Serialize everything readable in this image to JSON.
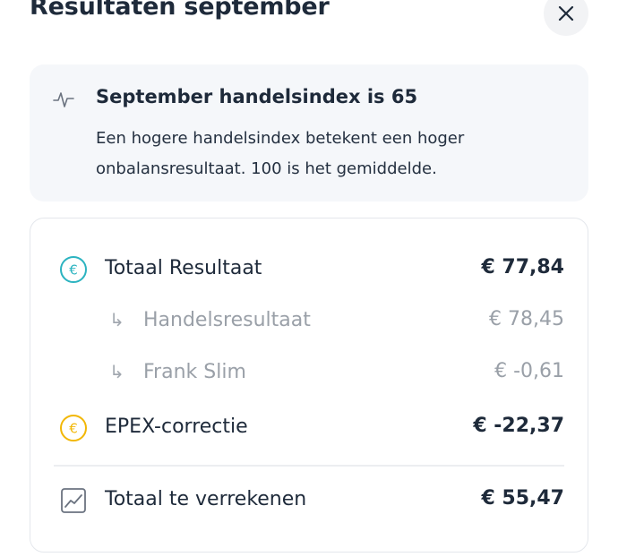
{
  "header": {
    "title": "Resultaten september",
    "close_icon": "close-icon"
  },
  "info": {
    "icon": "activity-icon",
    "heading": "September handelsindex is 65",
    "description": "Een hogere handelsindex betekent een hoger onbalansresultaat. 100 is het gemiddelde."
  },
  "results": {
    "rows": [
      {
        "icon": "euro-circle-icon",
        "label": "Totaal Resultaat",
        "value": "€ 77,84"
      },
      {
        "icon": "sub-arrow-icon",
        "label": "Handelsresultaat",
        "value": "€ 78,45"
      },
      {
        "icon": "sub-arrow-icon",
        "label": "Frank Slim",
        "value": "€ -0,61"
      },
      {
        "icon": "euro-circle-icon",
        "label": "EPEX-correctie",
        "value": "€ -22,37"
      },
      {
        "icon": "trend-chart-icon",
        "label": "Totaal te verrekenen",
        "value": "€ 55,47"
      }
    ],
    "colors": {
      "teal": "#2bb3c0",
      "amber": "#f2b705",
      "muted": "#9aa0a8"
    }
  }
}
